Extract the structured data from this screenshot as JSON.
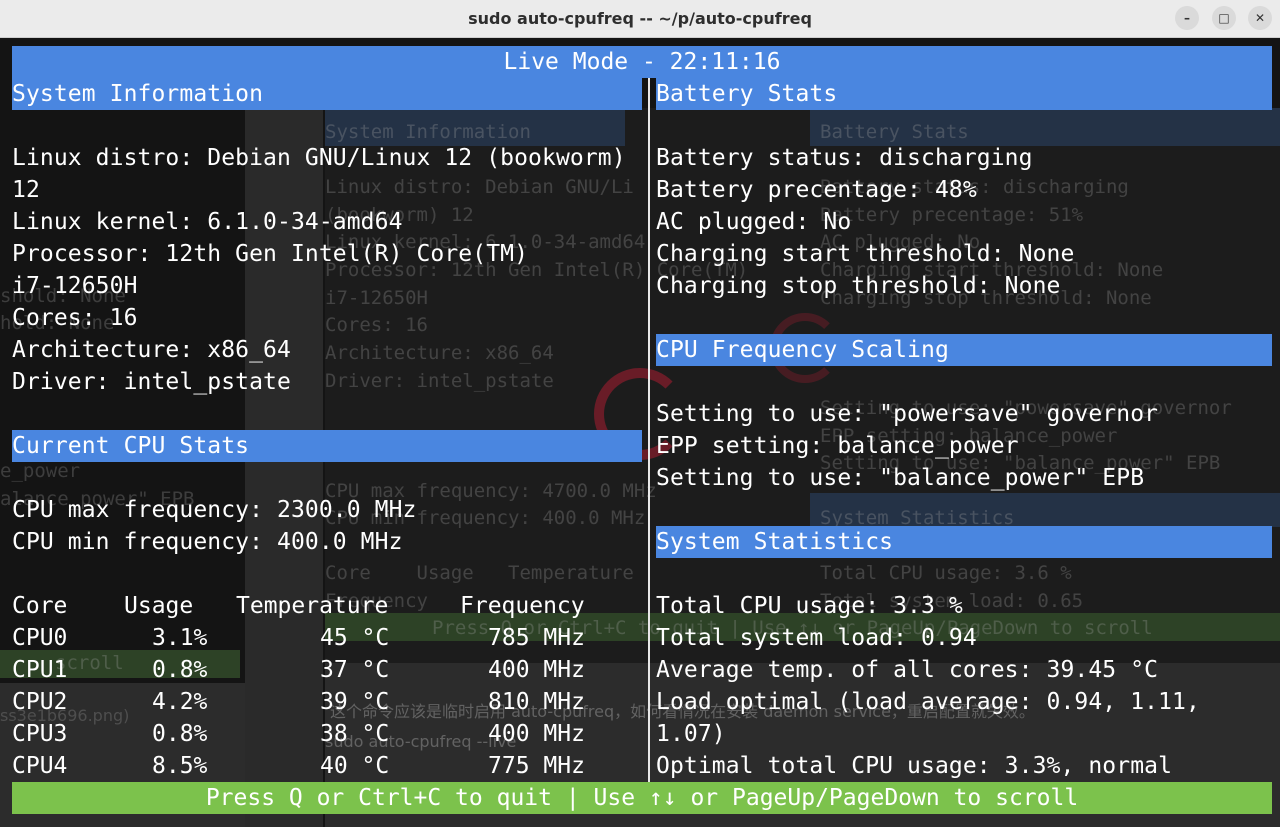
{
  "window": {
    "title": "sudo auto-cpufreq -- ~/p/auto-cpufreq",
    "minimize_icon": "minimize-icon",
    "maximize_icon": "maximize-icon",
    "close_icon": "close-icon"
  },
  "live_header": "Live Mode - 22:11:16",
  "system_info": {
    "title": "System Information",
    "lines": [
      "Linux distro: Debian GNU/Linux 12 (bookworm)",
      "12",
      "Linux kernel: 6.1.0-34-amd64",
      "Processor: 12th Gen Intel(R) Core(TM)",
      "i7-12650H",
      "Cores: 16",
      "Architecture: x86_64",
      "Driver: intel_pstate"
    ]
  },
  "cpu_stats": {
    "title": "Current CPU Stats",
    "max_freq": "CPU max frequency: 2300.0 MHz",
    "min_freq": "CPU min frequency: 400.0 MHz",
    "columns": [
      "Core",
      "Usage",
      "Temperature",
      "Frequency"
    ],
    "rows": [
      {
        "core": "CPU0",
        "usage": "3.1%",
        "temp": "45 °C",
        "freq": "785 MHz"
      },
      {
        "core": "CPU1",
        "usage": "0.8%",
        "temp": "37 °C",
        "freq": "400 MHz"
      },
      {
        "core": "CPU2",
        "usage": "4.2%",
        "temp": "39 °C",
        "freq": "810 MHz"
      },
      {
        "core": "CPU3",
        "usage": "0.8%",
        "temp": "38 °C",
        "freq": "400 MHz"
      },
      {
        "core": "CPU4",
        "usage": "8.5%",
        "temp": "40 °C",
        "freq": "775 MHz"
      }
    ]
  },
  "battery": {
    "title": "Battery Stats",
    "lines": [
      "Battery status: discharging",
      "Battery precentage: 48%",
      "AC plugged: No",
      "Charging start threshold: None",
      "Charging stop threshold: None"
    ]
  },
  "freq_scaling": {
    "title": "CPU Frequency Scaling",
    "lines": [
      "Setting to use: \"powersave\" governor",
      "EPP setting: balance_power",
      "Setting to use: \"balance_power\" EPB"
    ]
  },
  "sys_stats": {
    "title": "System Statistics",
    "lines": [
      "Total CPU usage: 3.3 %",
      "Total system load: 0.94",
      "Average temp. of all cores: 39.45 °C",
      "Load optimal (load average: 0.94, 1.11,",
      "1.07)",
      "Optimal total CPU usage: 3.3%, normal"
    ]
  },
  "footer": "Press Q or Ctrl+C to quit | Use ↑↓ or PageUp/PageDown to scroll",
  "ghost": {
    "sys_info": "System Information",
    "distro": "Linux distro: Debian GNU/Li",
    "distro2": "(bookworm) 12",
    "kernel": "Linux kernel: 6.1.0-34-amd64",
    "proc": "Processor: 12th Gen Intel(R) Core(TM)",
    "model": "i7-12650H",
    "cores": "Cores: 16",
    "arch": "Architecture: x86_64",
    "driver": "Driver: intel_pstate",
    "cpumax": "CPU max frequency: 4700.0 MHz",
    "cpumin": "CPU min frequency: 400.0 MHz",
    "cols": "Core    Usage   Temperature",
    "freqcol": "Frequency",
    "battery": "Battery Stats",
    "bstatus": "Battery status: discharging",
    "bpct": "Battery precentage: 51%",
    "ac": "AC plugged: No",
    "cstart": "Charging start threshold: None",
    "cstop": "Charging stop threshold: None",
    "setgov": "Setting to use: \"powersave\" governor",
    "epp": "EPP setting: balance_power",
    "setepb": "Setting to use: \"balance_power\" EPB",
    "sysstat": "System Statistics",
    "cpuusage": "Total CPU usage: 3.6 %",
    "sysload": "Total system load: 0.65",
    "pressq": "Press Q or Ctrl+C to quit | Use ↑↓ or PageUp/PageDown to scroll",
    "cn1": "这个命令应该是临时启用 auto-cpufreq，如何看情况在安装 daemon service，重启配置就失效。",
    "cn2": "sudo auto-cpufreq --live",
    "left1": "shold: None",
    "left2": "hold: None",
    "left3": "e_power",
    "left4": "alance_power\" EPB",
    "left5": "scroll",
    "left6": "ss3e1b696.png)"
  }
}
